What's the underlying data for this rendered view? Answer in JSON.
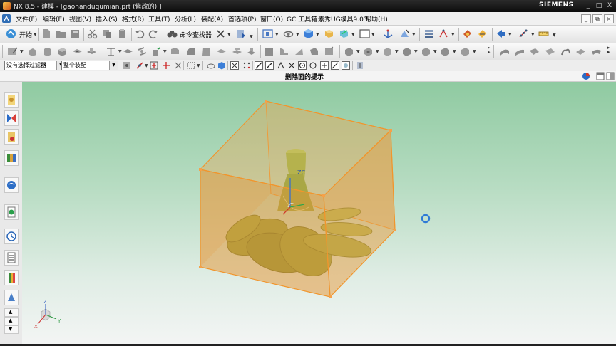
{
  "window": {
    "title": "NX 8.5 - 建模 - [gaonanduqumian.prt  (修改的) ]",
    "brand": "SIEMENS",
    "controls": {
      "minimize": "_",
      "maximize": "□",
      "close": "X"
    }
  },
  "menu": {
    "items": [
      "文件(F)",
      "编辑(E)",
      "视图(V)",
      "插入(S)",
      "格式(R)",
      "工具(T)",
      "分析(L)",
      "装配(A)",
      "首选项(P)",
      "窗口(O)",
      "GC 工具箱",
      "素秀UG模具9.03",
      "帮助(H)"
    ],
    "doc_controls": {
      "minimize": "_",
      "restore": "⧉",
      "close": "×"
    }
  },
  "toolbar": {
    "start_label": "开始",
    "command_finder_label": "命令查找器"
  },
  "selection_bar": {
    "filter_value": "没有选择过滤器",
    "scope_value": "整个装配"
  },
  "cue_line": {
    "text": "删除面的提示"
  },
  "viewport": {
    "wcs_label": "ZC",
    "triad": {
      "x": "X",
      "y": "Y",
      "z": "Z"
    }
  },
  "colors": {
    "box_face": "#e59a3f",
    "box_edge": "#f1952c",
    "part_green": "#8fa23a",
    "bg_top": "#8fcaa1",
    "bg_bottom": "#f3f5f4"
  }
}
